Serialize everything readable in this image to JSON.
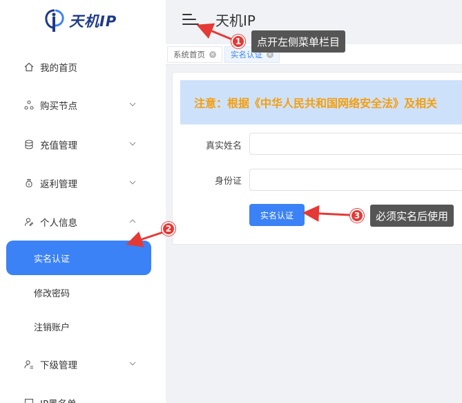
{
  "logo": {
    "text": "天机IP"
  },
  "header": {
    "title": "天机IP"
  },
  "sidebar": {
    "items": [
      {
        "label": "我的首页"
      },
      {
        "label": "购买节点"
      },
      {
        "label": "充值管理"
      },
      {
        "label": "返利管理"
      },
      {
        "label": "个人信息"
      },
      {
        "label": "下级管理"
      },
      {
        "label": "IP黑名单"
      }
    ],
    "sub_items": [
      {
        "label": "实名认证"
      },
      {
        "label": "修改密码"
      },
      {
        "label": "注销账户"
      }
    ]
  },
  "tabs": [
    {
      "label": "系统首页"
    },
    {
      "label": "实名认证"
    }
  ],
  "notice": {
    "text": "注意：根据《中华人民共和国网络安全法》及相关"
  },
  "form": {
    "name_label": "真实姓名",
    "id_label": "身份证",
    "submit_label": "实名认证"
  },
  "annotations": [
    {
      "number": "1",
      "text": "点开左侧菜单栏目"
    },
    {
      "number": "2"
    },
    {
      "number": "3",
      "text": "必须实名后使用"
    }
  ],
  "colors": {
    "accent": "#3b82f6",
    "notice_text": "#f59e0b",
    "annotation": "#e53935"
  }
}
